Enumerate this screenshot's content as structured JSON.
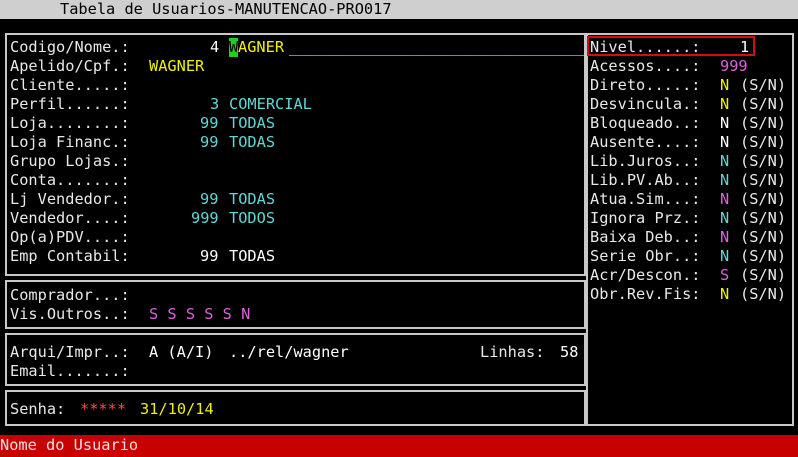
{
  "title": "Tabela de Usuarios-MANUTENCAO-PRO017",
  "left": {
    "codigo_label": "Codigo/Nome.:",
    "codigo_num": "4",
    "codigo_cursor": "W",
    "codigo_name_rest": "AGNER",
    "codigo_underscores": "___________________________________",
    "apelido_label": "Apelido/Cpf.:",
    "apelido_value": "WAGNER",
    "cliente_label": "Cliente.....:",
    "perfil_label": "Perfil......:",
    "perfil_num": "3",
    "perfil_text": "COMERCIAL",
    "loja_label": "Loja........:",
    "loja_num": "99",
    "loja_text": "TODAS",
    "lojafin_label": "Loja Financ.:",
    "lojafin_num": "99",
    "lojafin_text": "TODAS",
    "grupo_label": "Grupo Lojas.:",
    "conta_label": "Conta.......:",
    "ljvend_label": "Lj Vendedor.:",
    "ljvend_num": "99",
    "ljvend_text": "TODAS",
    "vend_label": "Vendedor....:",
    "vend_num": "999",
    "vend_text": "TODOS",
    "oppdv_label": "Op(a)PDV....:",
    "emp_label": "Emp Contabil:",
    "emp_num": "99",
    "emp_text": "TODAS",
    "comprador_label": "Comprador...:",
    "visoutros_label": "Vis.Outros..:",
    "visoutros_value": "S S S S S N",
    "arqui_label": "Arqui/Impr..:",
    "arqui_mode": "A (A/I)",
    "arqui_path": "../rel/wagner",
    "linhas_label": "Linhas:",
    "linhas_value": "58",
    "email_label": "Email.......:",
    "senha_label": "Senha:",
    "senha_mask": "*****",
    "senha_date": "31/10/14"
  },
  "right": {
    "nivel_label": "Nivel......:",
    "nivel_value": "1",
    "acessos_label": "Acessos....:",
    "acessos_value": "999",
    "flags": [
      {
        "label": "Direto.....:",
        "value": "N",
        "hint": "(S/N)"
      },
      {
        "label": "Desvincula.:",
        "value": "N",
        "hint": "(S/N)"
      },
      {
        "label": "Bloqueado..:",
        "value": "N",
        "hint": "(S/N)"
      },
      {
        "label": "Ausente....:",
        "value": "N",
        "hint": "(S/N)"
      },
      {
        "label": "Lib.Juros..:",
        "value": "N",
        "hint": "(S/N)"
      },
      {
        "label": "Lib.PV.Ab..:",
        "value": "N",
        "hint": "(S/N)"
      },
      {
        "label": "Atua.Sim...:",
        "value": "N",
        "hint": "(S/N)"
      },
      {
        "label": "Ignora Prz.:",
        "value": "N",
        "hint": "(S/N)"
      },
      {
        "label": "Baixa Deb..:",
        "value": "N",
        "hint": "(S/N)"
      },
      {
        "label": "Serie Obr..:",
        "value": "N",
        "hint": "(S/N)"
      },
      {
        "label": "Acr/Descon.:",
        "value": "S",
        "hint": "(S/N)"
      },
      {
        "label": "Obr.Rev.Fis:",
        "value": "N",
        "hint": "(S/N)"
      }
    ]
  },
  "status_bar": "Nome do Usuario",
  "colors": {
    "background": "#000000",
    "status_bar": "#c80000",
    "cursor": "#20d020",
    "frame_highlight": "#d01010",
    "cyan": "#5fd7d7",
    "yellow": "#f0f000",
    "magenta": "#e060e0"
  }
}
